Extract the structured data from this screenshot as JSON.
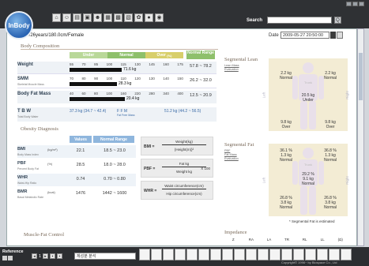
{
  "app": {
    "logo_text": "InBody"
  },
  "toolbar": {
    "icons": [
      "home-icon",
      "person-icon",
      "chart-icon",
      "book-icon",
      "group-icon",
      "grid-icon",
      "cube-icon",
      "document-icon",
      "settings-icon",
      "help-icon",
      "info-icon"
    ]
  },
  "search": {
    "label": "Search",
    "value": "",
    "go": "Q"
  },
  "patient": {
    "info": "37/26years/180.0cm/Female"
  },
  "date": {
    "label": "Date :",
    "selected": "2009-05-27 20:50:00"
  },
  "body_composition": {
    "title": "Body Composition",
    "columns": {
      "under": "Under",
      "normal": "Normal",
      "over": "Over",
      "over_unit": "(%)",
      "range": "Normal Range"
    },
    "rows": [
      {
        "label": "Weight",
        "sub": "",
        "ticks": [
          "55",
          "70",
          "85",
          "100",
          "115",
          "130",
          "145",
          "160",
          "175"
        ],
        "value_text": "71.6 kg",
        "value": 71.6,
        "range": "57.8 ~ 78.2"
      },
      {
        "label": "SMM",
        "sub": "Skeletal Muscle Mass",
        "ticks": [
          "70",
          "80",
          "90",
          "100",
          "110",
          "120",
          "130",
          "140",
          "150"
        ],
        "value_text": "28.3 kg",
        "value": 28.3,
        "range": "26.2 ~ 32.0"
      },
      {
        "label": "Body Fat Mass",
        "sub": "",
        "ticks": [
          "40",
          "60",
          "80",
          "100",
          "160",
          "220",
          "280",
          "340",
          "400"
        ],
        "value_text": "20.4 kg",
        "value": 20.4,
        "range": "12.5 ~ 20.9"
      }
    ],
    "tbw": {
      "label": "T B W",
      "sub": "Total Body Water",
      "val1": "37.3 kg (34.7 ~ 42.4)",
      "ffm_label": "F F M",
      "ffm_sub": "Fat Free Mass",
      "val2": "51.2 kg (44.2 ~ 56.5)"
    }
  },
  "obesity": {
    "title": "Obesity Diagnosis",
    "head_values": "Values",
    "head_range": "Normal Range",
    "rows": [
      {
        "label": "BMI",
        "unit": "(kg/m²)",
        "sub": "Body Mass Index",
        "value": "22.1",
        "range": "18.5 ~ 23.0"
      },
      {
        "label": "PBF",
        "unit": "(%)",
        "sub": "Percent Body Fat",
        "value": "28.5",
        "range": "18.0 ~ 28.0"
      },
      {
        "label": "WHR",
        "unit": "",
        "sub": "Waist-Hip Ratio",
        "value": "0.74",
        "range": "0.70 ~ 0.80"
      },
      {
        "label": "BMR",
        "unit": "(kcal)",
        "sub": "Basal Metabolic Rate",
        "value": "1476",
        "range": "1442 ~ 1600"
      }
    ],
    "formulas": [
      {
        "name": "BMI =",
        "num": "Weight(kg)",
        "den": "{Height(m)}²",
        "mul": ""
      },
      {
        "name": "PBF =",
        "num": "Fat kg",
        "den": "Weight kg",
        "mul": "X 100"
      },
      {
        "name": "WHR =",
        "num": "Waist circumference(cm)",
        "den": "Hip circumference(cm)",
        "mul": ""
      }
    ]
  },
  "muscle_fat": {
    "title": "Muscle-Fat Control"
  },
  "segmental_lean": {
    "title": "Segmental Lean",
    "sub": "Lean Mass\nEvaluation",
    "left_side": "Left",
    "right_side": "Right",
    "trunk_label": "Trunk",
    "ra": {
      "v1": "2.2 kg",
      "v2": "Normal"
    },
    "la": {
      "v1": "2.2 kg",
      "v2": "Normal"
    },
    "trunk": {
      "v1": "20.5 kg",
      "v2": "Under"
    },
    "rl": {
      "v1": "9.8 kg",
      "v2": "Over"
    },
    "ll": {
      "v1": "9.8 kg",
      "v2": "Over"
    }
  },
  "segmental_fat": {
    "title": "Segmental Fat",
    "sub": "PBF\nFat Mass\nEvaluation",
    "left_side": "Left",
    "right_side": "Right",
    "trunk_label": "Trunk",
    "ra": {
      "v1": "36.1 %",
      "v2": "1.3 kg",
      "v3": "Normal"
    },
    "la": {
      "v1": "36.8 %",
      "v2": "1.3 kg",
      "v3": "Normal"
    },
    "trunk": {
      "v1": "29.2 %",
      "v2": "9.1 kg",
      "v3": "Normal"
    },
    "rl": {
      "v1": "26.8 %",
      "v2": "3.8 kg",
      "v3": "Normal"
    },
    "ll": {
      "v1": "26.8 %",
      "v2": "3.8 kg",
      "v3": "Normal"
    },
    "note": "* Segmental Fat is estimated"
  },
  "impedance": {
    "title": "Impedance",
    "cols": [
      "Z",
      "RA",
      "LA",
      "TR",
      "RL",
      "LL",
      "(Ω)"
    ]
  },
  "taskbar": {
    "reference": "Reference",
    "page_num": "1",
    "lang": "체성분 분석",
    "copyright": "Copyright© 1996~ by Biospace Co., Ltd"
  }
}
